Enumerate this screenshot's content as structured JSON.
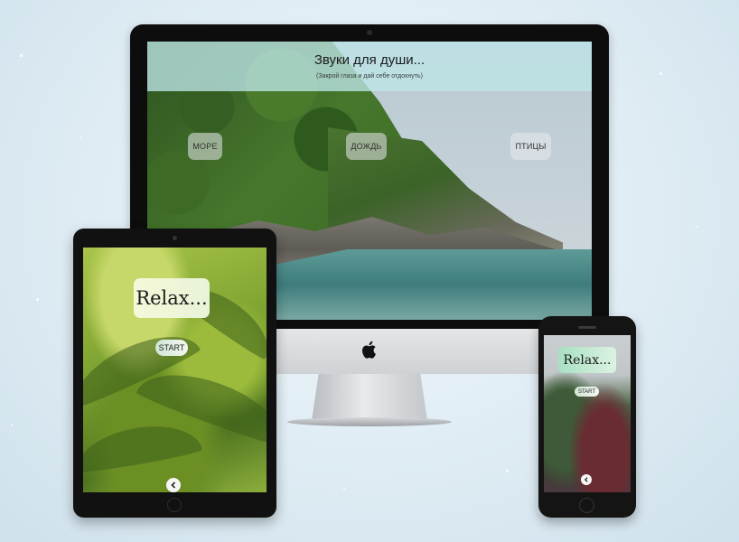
{
  "desktop": {
    "title": "Звуки для души...",
    "subtitle": "(Закрой глаза и дай себе отдохнуть)",
    "sounds": [
      {
        "label": "МОРЕ"
      },
      {
        "label": "ДОЖДЬ"
      },
      {
        "label": "ПТИЦЫ"
      }
    ]
  },
  "tablet": {
    "heading": "Relax...",
    "start_label": "START",
    "back_icon": "chevron-left-icon"
  },
  "phone": {
    "heading": "Relax...",
    "start_label": "START",
    "back_icon": "chevron-left-icon"
  },
  "device_logo": "apple-icon",
  "colors": {
    "header_overlay": "#bee6e8",
    "relax_box": "#f5f8d8",
    "relax_box_phone": "#a8e0c3",
    "start_button": "#cfe6d6"
  }
}
